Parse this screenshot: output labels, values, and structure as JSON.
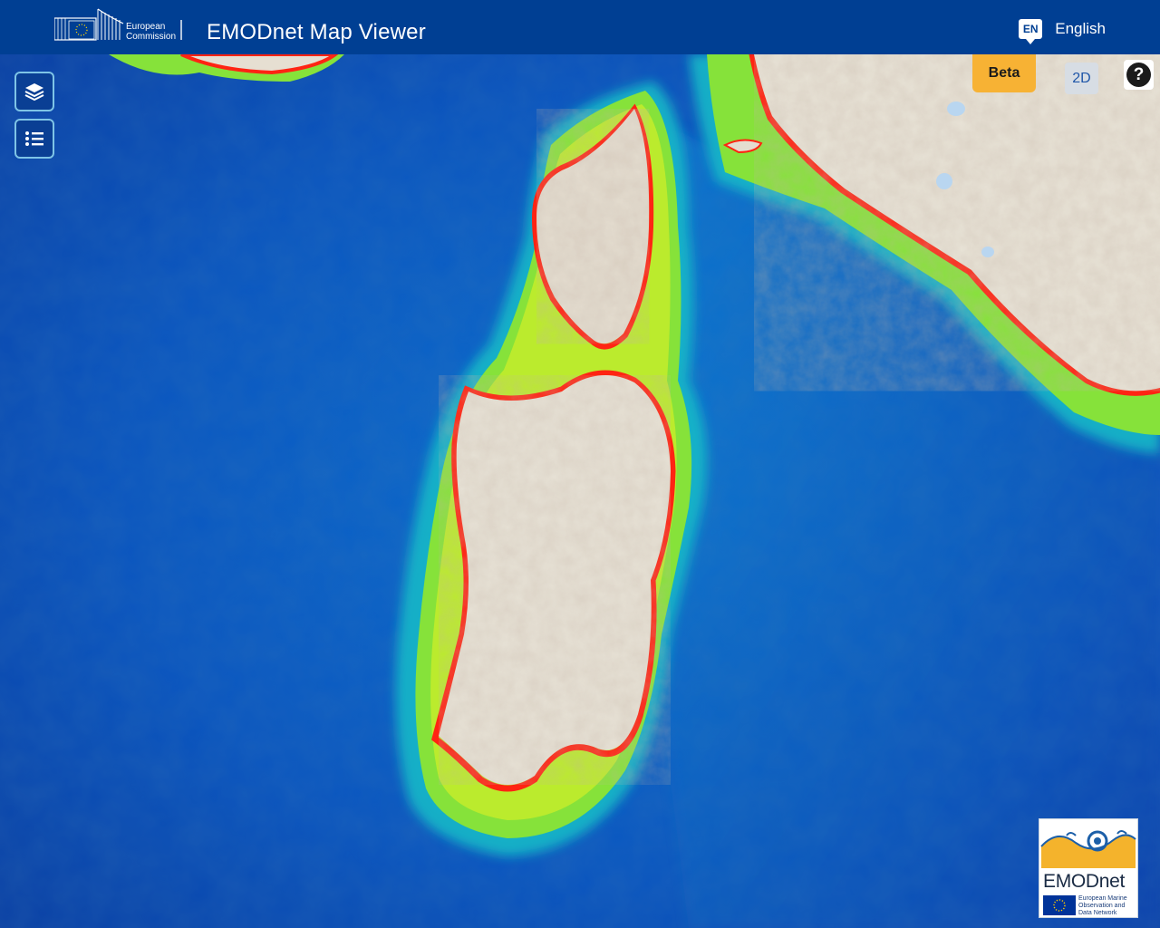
{
  "header": {
    "ec_logo_line1": "European",
    "ec_logo_line2": "Commission",
    "title": "EMODnet Map Viewer",
    "lang_code": "EN",
    "lang_label": "English"
  },
  "map_controls": {
    "layers_icon": "layers-icon",
    "list_icon": "list-icon",
    "beta_label": "Beta",
    "dimension_label": "2D",
    "help_label": "?"
  },
  "logo": {
    "word": "EMODnet",
    "sub_line1": "European Marine",
    "sub_line2": "Observation and",
    "sub_line3": "Data Network"
  },
  "colors": {
    "header_bg": "#003f93",
    "beta_bg": "#f7b234",
    "deep_sea": "#0a3fa3",
    "mid_sea": "#0a86d6",
    "shelf": "#14d0a8",
    "shallow": "#8ee830",
    "coast": "#ff2f13",
    "land": "#e7e2d6"
  }
}
